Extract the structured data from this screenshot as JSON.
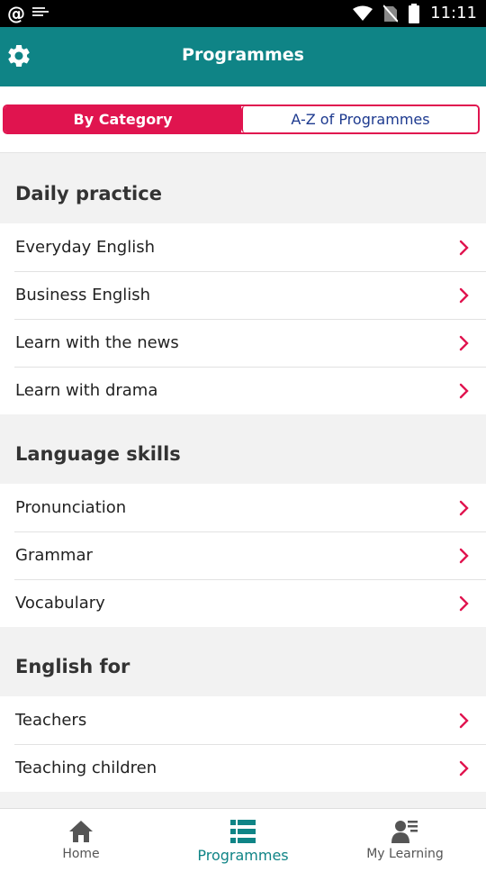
{
  "status_bar": {
    "time": "11:11",
    "icons": [
      "at-icon",
      "notification-icon",
      "wifi-icon",
      "no-sim-icon",
      "battery-icon"
    ]
  },
  "header": {
    "title": "Programmes",
    "settings_icon": "gear-icon",
    "color": "#0f8486"
  },
  "tabs": {
    "by_category": "By Category",
    "az": "A-Z of Programmes",
    "accent": "#e0144f"
  },
  "sections": [
    {
      "title": "Daily practice",
      "items": [
        "Everyday English",
        "Business English",
        "Learn with the news",
        "Learn with drama"
      ]
    },
    {
      "title": "Language skills",
      "items": [
        "Pronunciation",
        "Grammar",
        "Vocabulary"
      ]
    },
    {
      "title": "English for",
      "items": [
        "Teachers",
        "Teaching children"
      ]
    }
  ],
  "bottom_nav": {
    "home": "Home",
    "programmes": "Programmes",
    "my_learning": "My Learning",
    "active": "programmes"
  }
}
